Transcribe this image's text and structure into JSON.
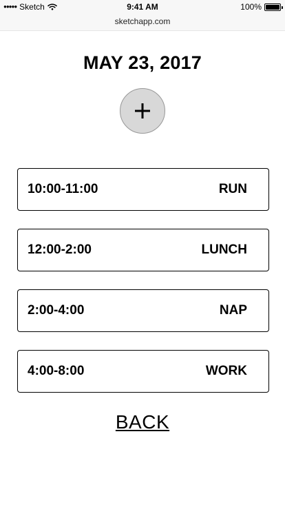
{
  "status_bar": {
    "carrier": "Sketch",
    "time": "9:41 AM",
    "battery": "100%",
    "signal_dots": "●●●●●",
    "icons": [
      "wifi-icon",
      "battery-icon"
    ]
  },
  "browser": {
    "url": "sketchapp.com"
  },
  "page": {
    "date": "MAY 23, 2017",
    "add_icon": "plus-icon",
    "back_label": "BACK"
  },
  "events": [
    {
      "time": "10:00-11:00",
      "label": "RUN"
    },
    {
      "time": "12:00-2:00",
      "label": "LUNCH"
    },
    {
      "time": "2:00-4:00",
      "label": "NAP"
    },
    {
      "time": "4:00-8:00",
      "label": "WORK"
    }
  ],
  "colors": {
    "background": "#ffffff",
    "add_button_fill": "#d8d8d8",
    "add_button_border": "#979797",
    "text": "#000000"
  }
}
